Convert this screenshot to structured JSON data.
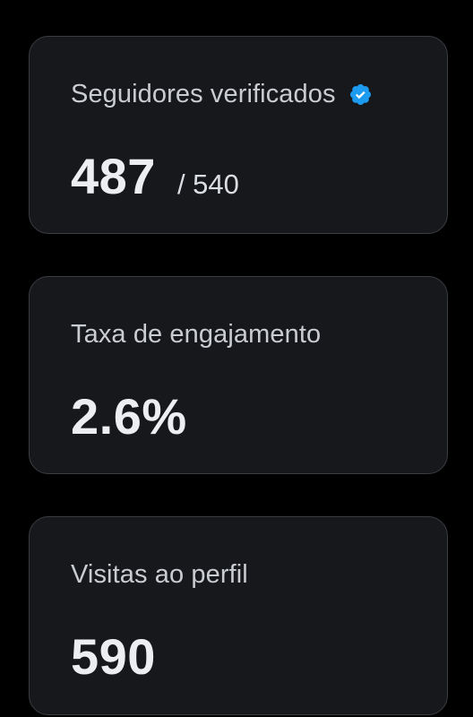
{
  "colors": {
    "background": "#000000",
    "card_background": "#17181c",
    "card_border": "#3a3d42",
    "verified_badge": "#1d9bf0"
  },
  "metrics": [
    {
      "title": "Seguidores verificados",
      "icon": "verified-badge-icon",
      "value": "487",
      "sub": "/ 540"
    },
    {
      "title": "Taxa de engajamento",
      "value": "2.6%"
    },
    {
      "title": "Visitas ao perfil",
      "value": "590"
    }
  ]
}
